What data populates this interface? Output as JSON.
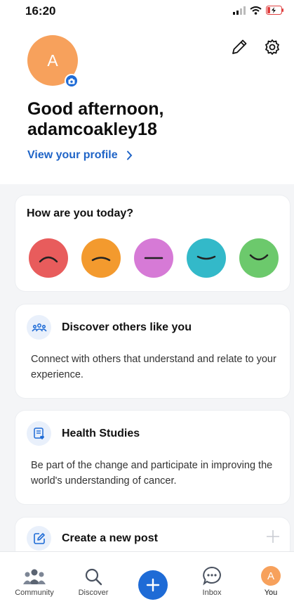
{
  "status_bar": {
    "time": "16:20"
  },
  "profile": {
    "avatar_letter": "A",
    "greeting_line1": "Good afternoon,",
    "greeting_line2": "adamcoakley18",
    "view_profile_label": "View your profile"
  },
  "mood": {
    "title": "How are you today?",
    "faces": [
      {
        "name": "very-sad",
        "color": "#e85c5c"
      },
      {
        "name": "sad",
        "color": "#f39a2e"
      },
      {
        "name": "neutral",
        "color": "#d67ad6"
      },
      {
        "name": "content",
        "color": "#33b9c9"
      },
      {
        "name": "happy",
        "color": "#6cc96c"
      }
    ]
  },
  "cards": {
    "discover": {
      "title": "Discover others like you",
      "description": "Connect with others that understand and relate to your experience."
    },
    "studies": {
      "title": "Health Studies",
      "description": "Be part of the change and participate in improving the world's understanding of cancer."
    },
    "post": {
      "title": "Create a new post"
    }
  },
  "tabbar": {
    "community": "Community",
    "discover": "Discover",
    "inbox": "Inbox",
    "you": "You",
    "you_avatar_letter": "A"
  },
  "colors": {
    "accent": "#1e6bd6",
    "avatar": "#f7a15c",
    "link": "#1f64c7"
  }
}
